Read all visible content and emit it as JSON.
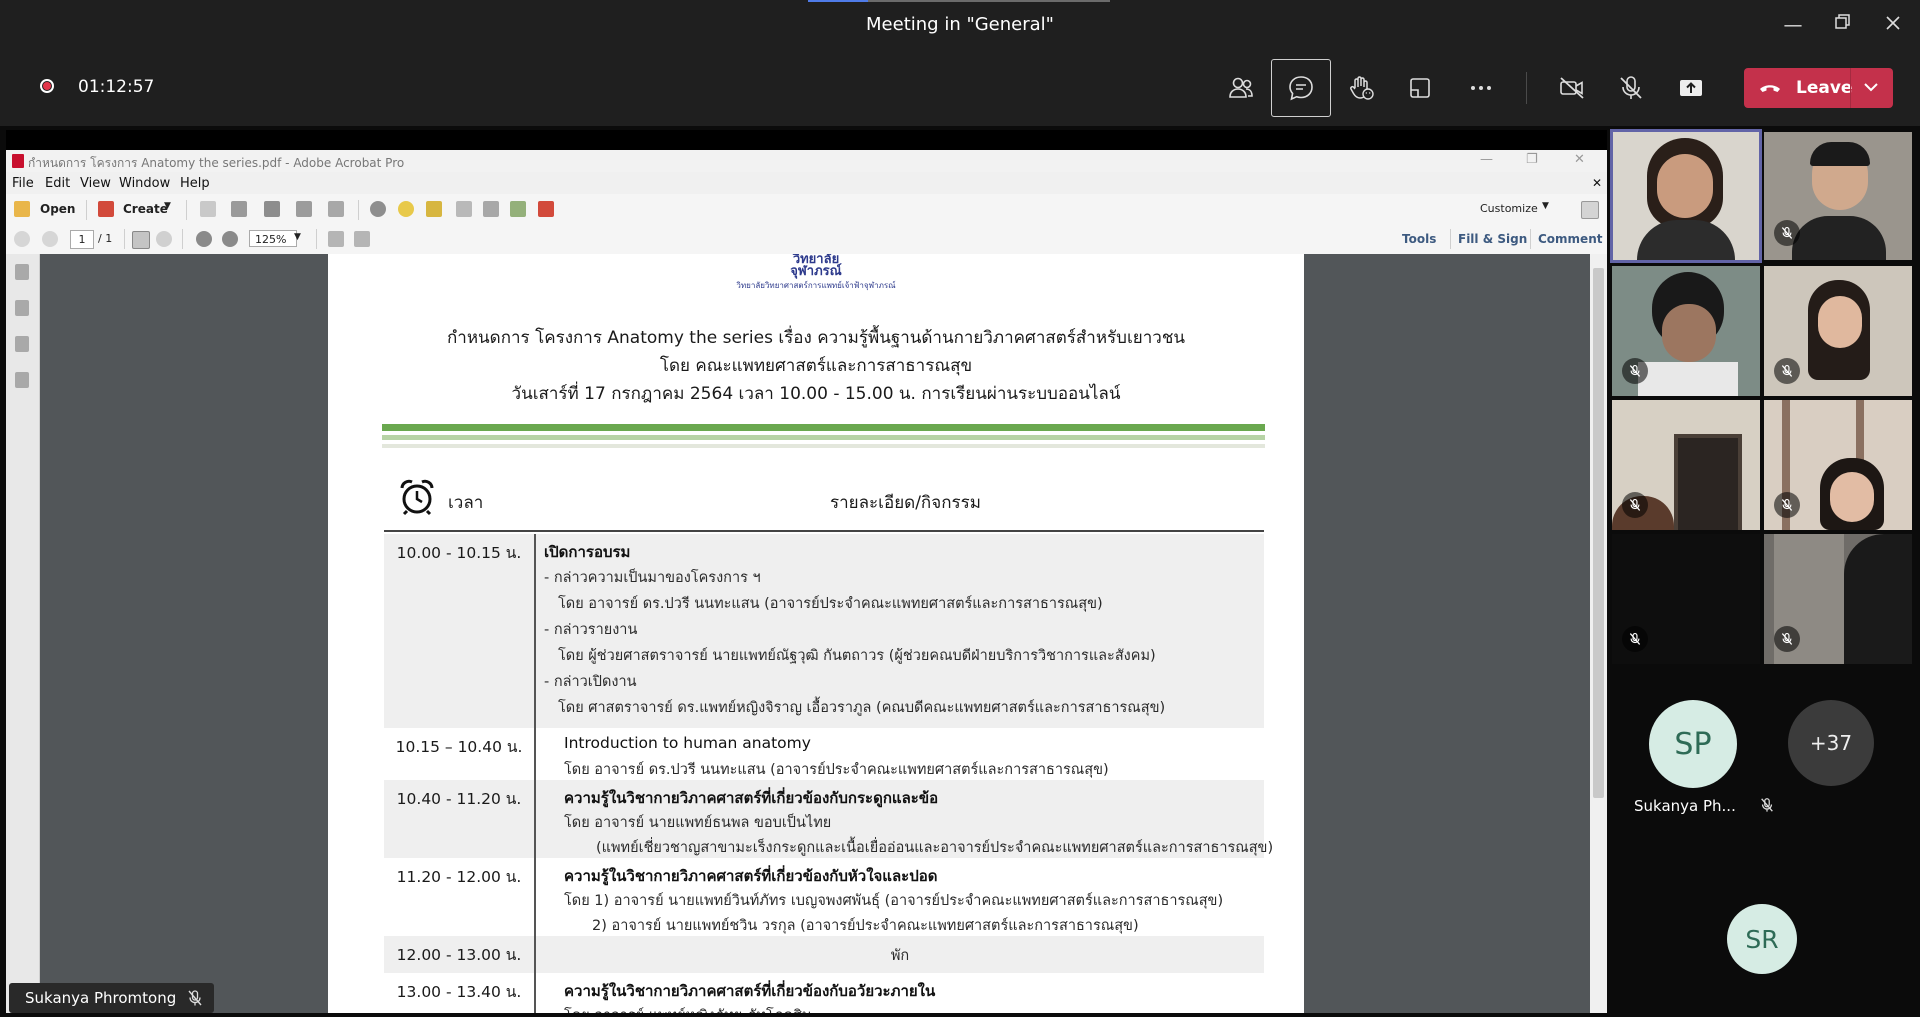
{
  "window": {
    "title": "Meeting in \"General\""
  },
  "meeting": {
    "timer": "01:12:57",
    "leave_label": "Leave"
  },
  "acrobat": {
    "title": "กำหนดการ โครงการ Anatomy the series.pdf - Adobe Acrobat Pro",
    "menu": [
      "File",
      "Edit",
      "View",
      "Window",
      "Help"
    ],
    "open_label": "Open",
    "create_label": "Create",
    "customize_label": "Customize",
    "page_current": "1",
    "page_total": "/ 1",
    "zoom": "125%",
    "tools_label": "Tools",
    "fillsign_label": "Fill & Sign",
    "comment_label": "Comment"
  },
  "document": {
    "logo_line1": "วิทยาลัย",
    "logo_line2": "จุฬาภรณ์",
    "logo_line3": "วิทยาลัยวิทยาศาสตร์การแพทย์เจ้าฟ้าจุฬาภรณ์",
    "heading1": "กำหนดการ โครงการ Anatomy the series เรื่อง ความรู้พื้นฐานด้านกายวิภาคศาสตร์สำหรับเยาวชน",
    "heading2": "โดย คณะแพทยศาสตร์และการสาธารณสุข",
    "heading3": "วันเสาร์ที่ 17 กรกฎาคม 2564 เวลา 10.00 - 15.00 น. การเรียนผ่านระบบออนไลน์",
    "col_time": "เวลา",
    "col_detail": "รายละเอียด/กิจกรรม",
    "rows": [
      {
        "time": "10.00 - 10.15 น.",
        "lines": [
          "เปิดการอบรม",
          "-  กล่าวความเป็นมาของโครงการ ฯ",
          "โดย   อาจารย์ ดร.ปวรี นนทะแสน (อาจารย์ประจำคณะแพทยศาสตร์และการสาธารณสุข)",
          "-  กล่าวรายงาน",
          "โดย   ผู้ช่วยศาสตราจารย์ นายแพทย์ณัฐวุฒิ กันตถาวร (ผู้ช่วยคณบดีฝ่ายบริการวิชาการและสังคม)",
          "-  กล่าวเปิดงาน",
          "โดย    ศาสตราจารย์ ดร.แพทย์หญิงจิราญ  เอื้อวราภูล (คณบดีคณะแพทยศาสตร์และการสาธารณสุข)"
        ]
      },
      {
        "time": "10.15 – 10.40 น.",
        "lines": [
          "Introduction to human anatomy",
          "โดย   อาจารย์ ดร.ปวรี  นนทะแสน (อาจารย์ประจำคณะแพทยศาสตร์และการสาธารณสุข)"
        ]
      },
      {
        "time": "10.40 - 11.20 น.",
        "lines": [
          "ความรู้ในวิชากายวิภาคศาสตร์ที่เกี่ยวข้องกับกระดูกและข้อ",
          "โดย  อาจารย์ นายแพทย์ธนพล ขอบเป็นไทย",
          "(แพทย์เชี่ยวชาญสาขามะเร็งกระดูกและเนื้อเยื่ออ่อนและอาจารย์ประจำคณะแพทยศาสตร์และการสาธารณสุข)"
        ]
      },
      {
        "time": "11.20 - 12.00 น.",
        "lines": [
          "ความรู้ในวิชากายวิภาคศาสตร์ที่เกี่ยวข้องกับหัวใจและปอด",
          "โดย 1) อาจารย์ นายแพทย์วินท์ภัทร เบญจพงศพันธุ์  (อาจารย์ประจำคณะแพทยศาสตร์และการสาธารณสุข)",
          "2) อาจารย์ นายแพทย์ชวิน วรกุล  (อาจารย์ประจำคณะแพทยศาสตร์และการสาธารณสุข)"
        ]
      },
      {
        "time": "12.00 - 13.00 น.",
        "lines": [
          "พัก"
        ]
      },
      {
        "time": "13.00 - 13.40 น.",
        "lines": [
          "ความรู้ในวิชากายวิภาคศาสตร์ที่เกี่ยวข้องกับอวัยวะภายใน",
          "โดย  อาจารย์ แพทย์หญิงภัทย ภัทโภคสิน"
        ]
      }
    ]
  },
  "presenter": {
    "name": "Sukanya Phromtong"
  },
  "participants": {
    "sp_initials": "SP",
    "sp_name": "Sukanya Ph...",
    "more_count": "+37",
    "sr_initials": "SR"
  },
  "colors": {
    "teams_bar": "#1f1f1f",
    "leave_red": "#c4314b",
    "green_bar": "#6aa84f",
    "avatar_sp_bg": "#d6ece4",
    "avatar_sp_fg": "#2e6b56",
    "avatar_more_bg": "#3b3b3b"
  }
}
